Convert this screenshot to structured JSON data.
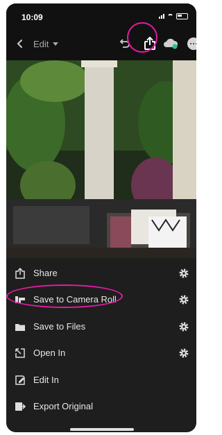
{
  "status_bar": {
    "time": "10:09"
  },
  "app_bar": {
    "edit_label": "Edit"
  },
  "menu": {
    "items": [
      {
        "label": "Share",
        "icon": "share-icon",
        "has_settings": true
      },
      {
        "label": "Save to Camera Roll",
        "icon": "camera-roll-icon",
        "has_settings": true
      },
      {
        "label": "Save to Files",
        "icon": "folder-icon",
        "has_settings": true
      },
      {
        "label": "Open In",
        "icon": "open-in-icon",
        "has_settings": true
      },
      {
        "label": "Edit In",
        "icon": "edit-in-icon",
        "has_settings": false
      },
      {
        "label": "Export Original",
        "icon": "export-original-icon",
        "has_settings": false
      }
    ]
  },
  "colors": {
    "highlight": "#e61aa6",
    "background": "#1e1e1e",
    "accent_cloud": "#2cbf9a"
  }
}
